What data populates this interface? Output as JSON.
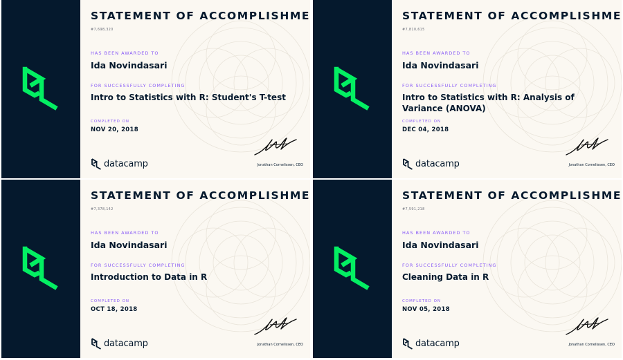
{
  "heading": "STATEMENT OF ACCOMPLISHMENT",
  "labels": {
    "awarded": "HAS BEEN AWARDED TO",
    "completing": "FOR SUCCESSFULLY COMPLETING",
    "completed_on": "COMPLETED ON"
  },
  "brand": {
    "name": "datacamp",
    "primary_color": "#03ef62",
    "dark_color": "#05192d",
    "accent_color": "#8a5cf6"
  },
  "signer": "Jonathan Cornelissen, CEO",
  "certificates": [
    {
      "id": "#7,698,320",
      "recipient": "Ida Novindasari",
      "course": "Intro to Statistics with R: Student's T-test",
      "completed": "NOV 20, 2018"
    },
    {
      "id": "#7,810,615",
      "recipient": "Ida Novindasari",
      "course": "Intro to Statistics with R: Analysis of Variance (ANOVA)",
      "completed": "DEC 04, 2018"
    },
    {
      "id": "#7,378,142",
      "recipient": "Ida Novindasari",
      "course": "Introduction to Data in R",
      "completed": "OCT 18, 2018"
    },
    {
      "id": "#7,591,218",
      "recipient": "Ida Novindasari",
      "course": "Cleaning Data in R",
      "completed": "NOV 05, 2018"
    }
  ]
}
